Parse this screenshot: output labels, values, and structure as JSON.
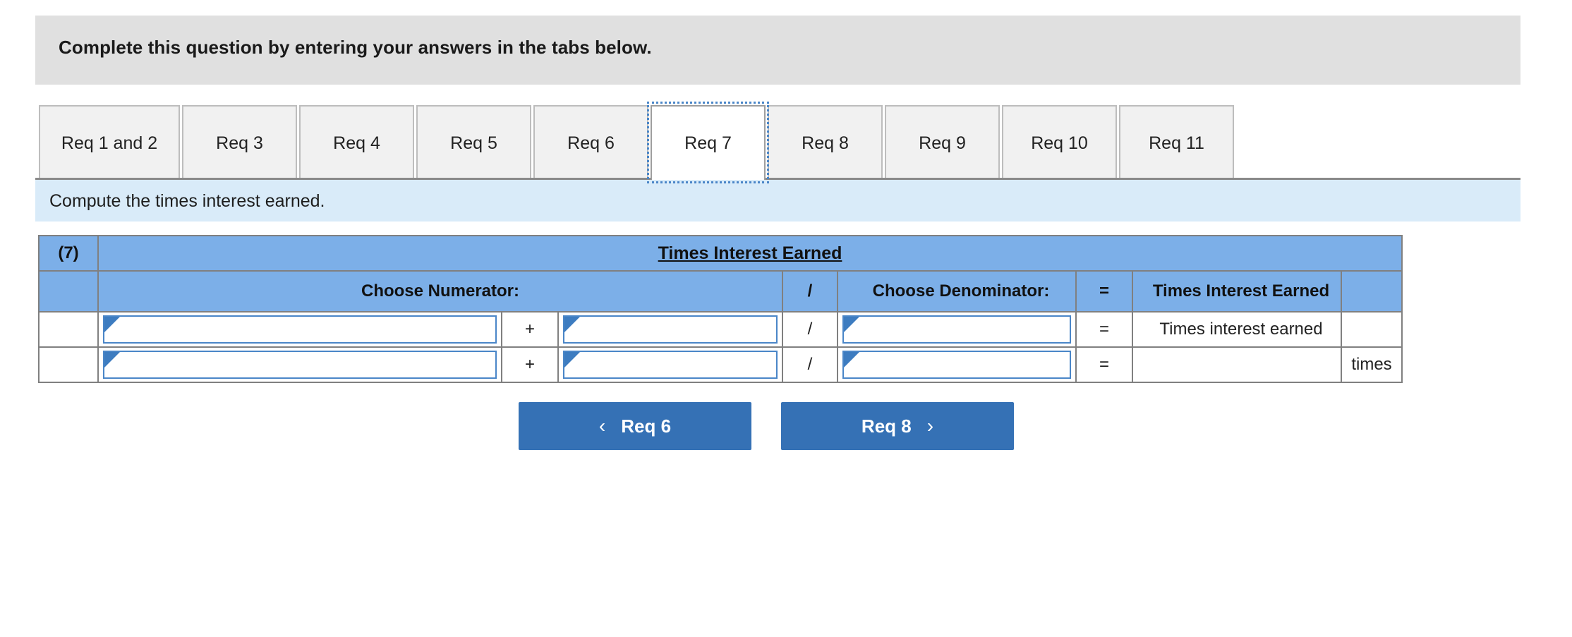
{
  "banner": {
    "text": "Complete this question by entering your answers in the tabs below."
  },
  "tabs": [
    {
      "label": "Req 1 and 2",
      "selected": false
    },
    {
      "label": "Req 3",
      "selected": false
    },
    {
      "label": "Req 4",
      "selected": false
    },
    {
      "label": "Req 5",
      "selected": false
    },
    {
      "label": "Req 6",
      "selected": false
    },
    {
      "label": "Req 7",
      "selected": true
    },
    {
      "label": "Req 8",
      "selected": false
    },
    {
      "label": "Req 9",
      "selected": false
    },
    {
      "label": "Req 10",
      "selected": false
    },
    {
      "label": "Req 11",
      "selected": false
    }
  ],
  "requirement": {
    "text": "Compute the times interest earned."
  },
  "table": {
    "req_number": "(7)",
    "title": "Times Interest Earned",
    "columns": {
      "numerator": "Choose Numerator:",
      "slash": "/",
      "denominator": "Choose Denominator:",
      "equals": "=",
      "result": "Times Interest Earned",
      "unit": ""
    },
    "rows": [
      {
        "index_label": "",
        "numerator_a": "",
        "operator": "+",
        "numerator_b": "",
        "divider": "/",
        "denominator": "",
        "equals": "=",
        "result": "Times interest earned",
        "unit": ""
      },
      {
        "index_label": "",
        "numerator_a": "",
        "operator": "+",
        "numerator_b": "",
        "divider": "/",
        "denominator": "",
        "equals": "=",
        "result": "",
        "unit": "times"
      }
    ]
  },
  "navigation": {
    "prev_label": "Req 6",
    "next_label": "Req 8",
    "prev_chevron": "‹",
    "next_chevron": "›"
  },
  "colors": {
    "banner_bg": "#e0e0e0",
    "reqbar_bg": "#d9ebf9",
    "table_header_bg": "#7cafe8",
    "accent_blue": "#4a86c8",
    "button_blue": "#3571b5"
  }
}
